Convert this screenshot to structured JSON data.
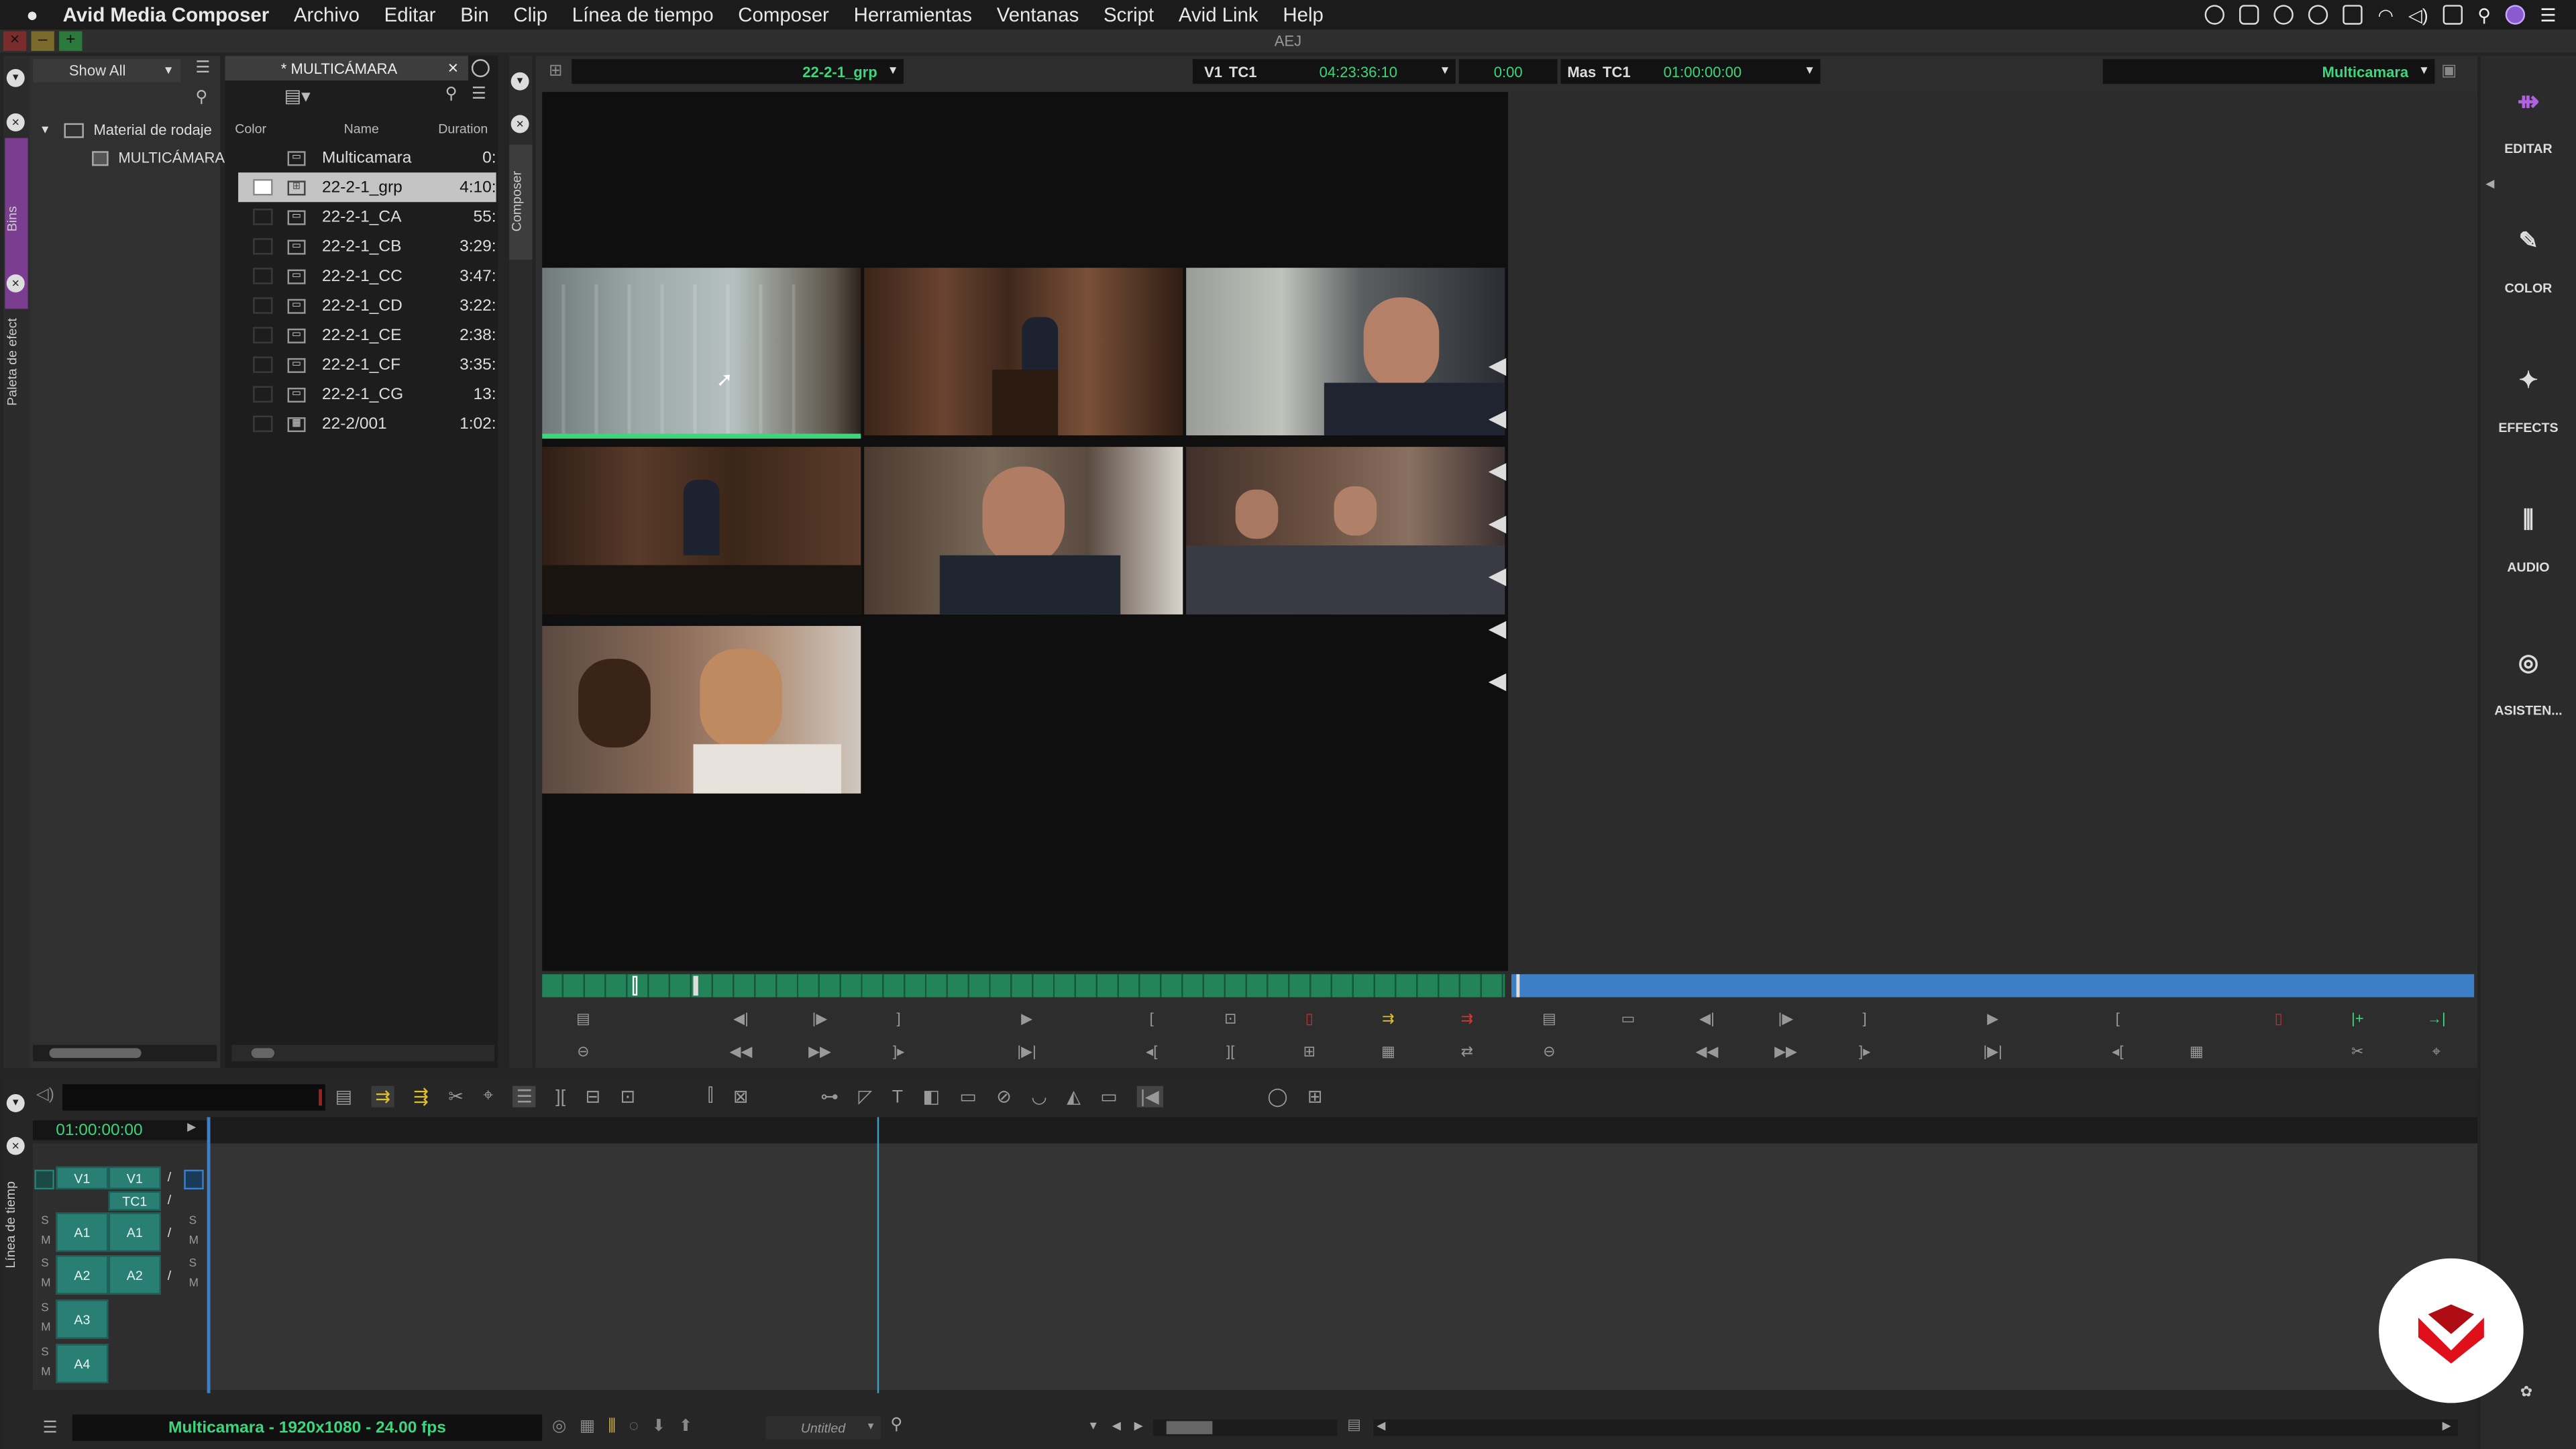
{
  "menubar": {
    "apple": "",
    "app": "Avid Media Composer",
    "items": [
      "Archivo",
      "Editar",
      "Bin",
      "Clip",
      "Línea de tiempo",
      "Composer",
      "Herramientas",
      "Ventanas",
      "Script",
      "Avid Link",
      "Help"
    ]
  },
  "title": "AEJ",
  "side_tabs": {
    "bins": "Bins",
    "effects": "Paleta de efect",
    "composer": "Composer",
    "timeline": "Línea de tiemp"
  },
  "project": {
    "filter": "Show All",
    "folder": "Material de rodaje",
    "sub": "MULTICÁMARA"
  },
  "bin": {
    "tab": "* MULTICÁMARA",
    "headers": {
      "color": "Color",
      "name": "Name",
      "duration": "Duration"
    },
    "rows": [
      {
        "name": "Multicamara",
        "duration": "0:"
      },
      {
        "name": "22-2-1_grp",
        "duration": "4:10:"
      },
      {
        "name": "22-2-1_CA",
        "duration": "55:"
      },
      {
        "name": "22-2-1_CB",
        "duration": "3:29:"
      },
      {
        "name": "22-2-1_CC",
        "duration": "3:47:"
      },
      {
        "name": "22-2-1_CD",
        "duration": "3:22:"
      },
      {
        "name": "22-2-1_CE",
        "duration": "2:38:"
      },
      {
        "name": "22-2-1_CF",
        "duration": "3:35:"
      },
      {
        "name": "22-2-1_CG",
        "duration": "13:"
      },
      {
        "name": "22-2/001",
        "duration": "1:02:"
      }
    ]
  },
  "composer": {
    "source_name": "22-2-1_grp",
    "v1": "V1",
    "tc1": "TC1",
    "source_tc": "04:23:36:10",
    "dur": "0:00",
    "mas": "Mas",
    "tc1b": "TC1",
    "record_tc": "01:00:00:00",
    "record_name": "Multicamara"
  },
  "timeline": {
    "tc": "01:00:00:00",
    "tracks_src": [
      "V1",
      "A1",
      "A2",
      "A3",
      "A4"
    ],
    "tracks_rec": [
      "V1",
      "TC1",
      "A1",
      "A2"
    ],
    "sm": [
      "S",
      "M"
    ],
    "status": "Multicamara - 1920x1080 - 24.00 fps",
    "bin_name": "Untitled"
  },
  "palette": [
    {
      "label": "EDITAR"
    },
    {
      "label": "COLOR"
    },
    {
      "label": "EFFECTS"
    },
    {
      "label": "AUDIO"
    },
    {
      "label": "ASISTEN..."
    }
  ],
  "colors": {
    "accent_green": "#3cd67c",
    "track_teal": "#2a7f74",
    "brand_red": "#e0101a",
    "timeline_blue": "#3d7fc7"
  }
}
